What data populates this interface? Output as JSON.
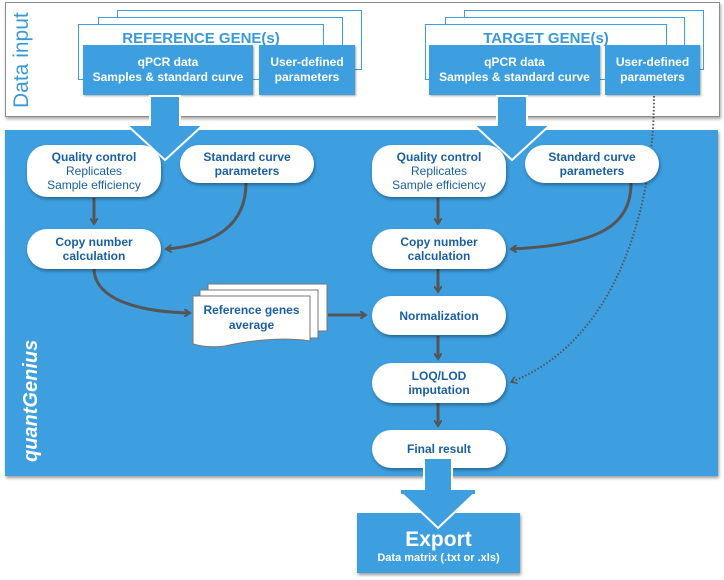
{
  "data_input": {
    "label": "Data input",
    "reference": {
      "title": "REFERENCE GENE(s)",
      "qpcr_line1": "qPCR data",
      "qpcr_line2": "Samples & standard curve",
      "params_line1": "User-defined",
      "params_line2": "parameters"
    },
    "target": {
      "title": "TARGET GENE(s)",
      "qpcr_line1": "qPCR data",
      "qpcr_line2": "Samples & standard curve",
      "params_line1": "User-defined",
      "params_line2": "parameters"
    }
  },
  "main": {
    "label": "quantGenius",
    "left": {
      "quality_control": {
        "title": "Quality control",
        "line2": "Replicates",
        "line3": "Sample efficiency"
      },
      "standard_curve": {
        "line1": "Standard curve",
        "line2": "parameters"
      },
      "copy_number": {
        "line1": "Copy number",
        "line2": "calculation"
      }
    },
    "reference_average": {
      "line1": "Reference genes",
      "line2": "average"
    },
    "right": {
      "quality_control": {
        "title": "Quality control",
        "line2": "Replicates",
        "line3": "Sample efficiency"
      },
      "standard_curve": {
        "line1": "Standard curve",
        "line2": "parameters"
      },
      "copy_number": {
        "line1": "Copy number",
        "line2": "calculation"
      },
      "normalization": "Normalization",
      "loq_lod": {
        "line1": "LOQ/LOD",
        "line2": "imputation"
      },
      "final_result": "Final result"
    }
  },
  "export": {
    "title": "Export",
    "subtitle": "Data matrix (.txt or .xls)"
  },
  "colors": {
    "accent_blue": "#3d9ee0",
    "node_text": "#1a5fa3",
    "connector": "#555555"
  }
}
